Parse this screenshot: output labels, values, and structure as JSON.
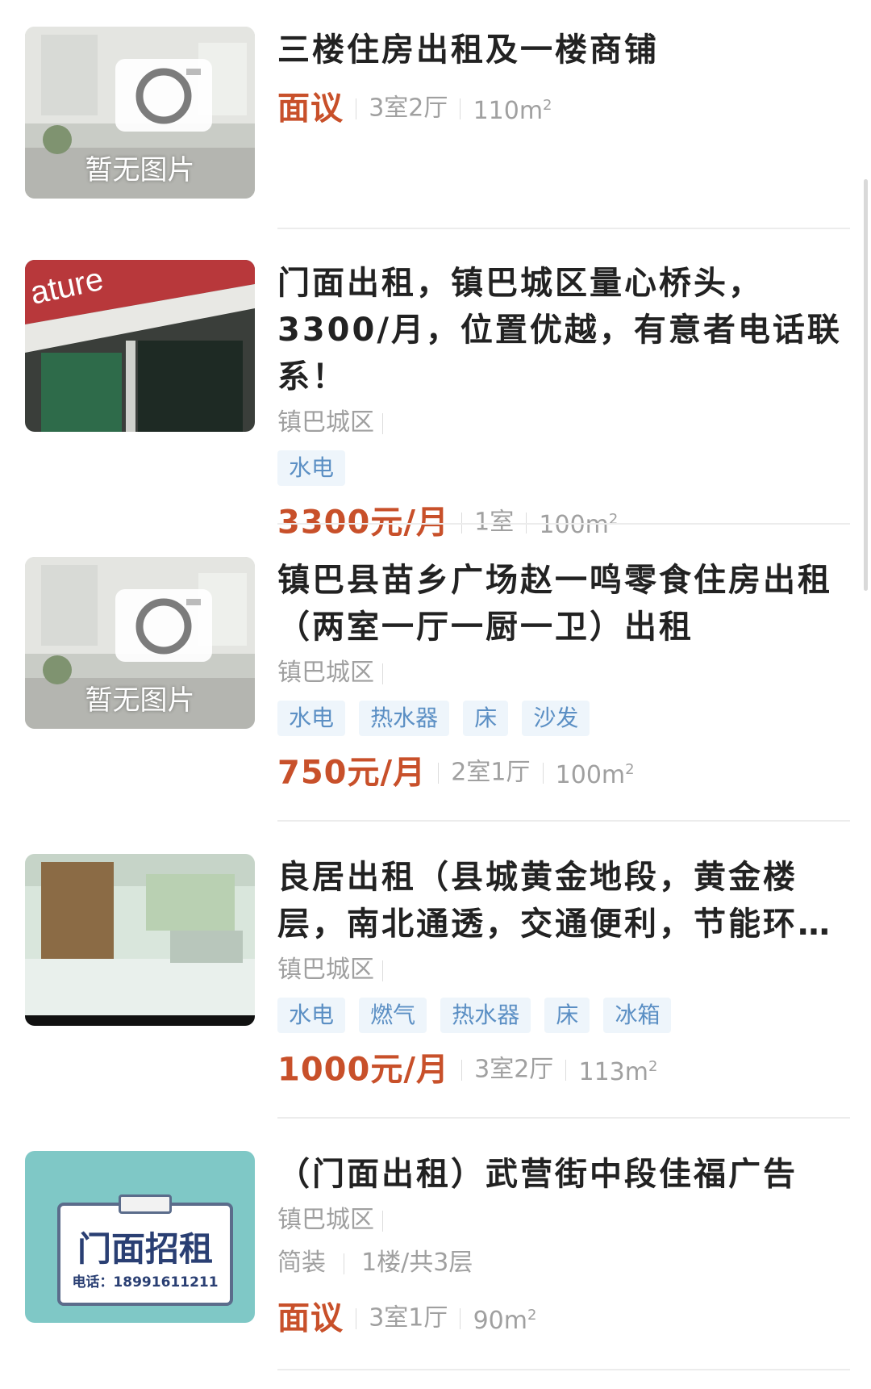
{
  "listings": [
    {
      "title": "三楼住房出租及一楼商铺",
      "image_label": "暂无图片",
      "price": "面议",
      "layout": "3室2厅",
      "area": "110m",
      "area_unit_sup": "2"
    },
    {
      "title": "门面出租，镇巴城区量心桥头，3300/月，位置优越，有意者电话联系！",
      "location": "镇巴城区",
      "tags": [
        "水电"
      ],
      "price": "3300元/月",
      "layout": "1室",
      "area": "100m",
      "area_unit_sup": "2"
    },
    {
      "title": "镇巴县苗乡广场赵一鸣零食住房出租（两室一厅一厨一卫）出租",
      "image_label": "暂无图片",
      "location": "镇巴城区",
      "tags": [
        "水电",
        "热水器",
        "床",
        "沙发"
      ],
      "price": "750元/月",
      "layout": "2室1厅",
      "area": "100m",
      "area_unit_sup": "2"
    },
    {
      "title": "良居出租（县城黄金地段，黄金楼层，南北通透，交通便利，节能环…",
      "location": "镇巴城区",
      "tags": [
        "水电",
        "燃气",
        "热水器",
        "床",
        "冰箱"
      ],
      "price": "1000元/月",
      "layout": "3室2厅",
      "area": "113m",
      "area_unit_sup": "2"
    },
    {
      "title": "（门面出租）武营街中段佳福广告",
      "image_sign_title": "门面招租",
      "image_sign_phone": "电话：18991611211",
      "location": "镇巴城区",
      "decoration": "简装",
      "floor": "1楼/共3层",
      "price": "面议",
      "layout": "3室1厅",
      "area": "90m",
      "area_unit_sup": "2"
    }
  ],
  "colors": {
    "price": "#c8502a",
    "tag_text": "#5b8fc4",
    "tag_bg": "#eef5fb",
    "muted": "#a0a0a0"
  }
}
